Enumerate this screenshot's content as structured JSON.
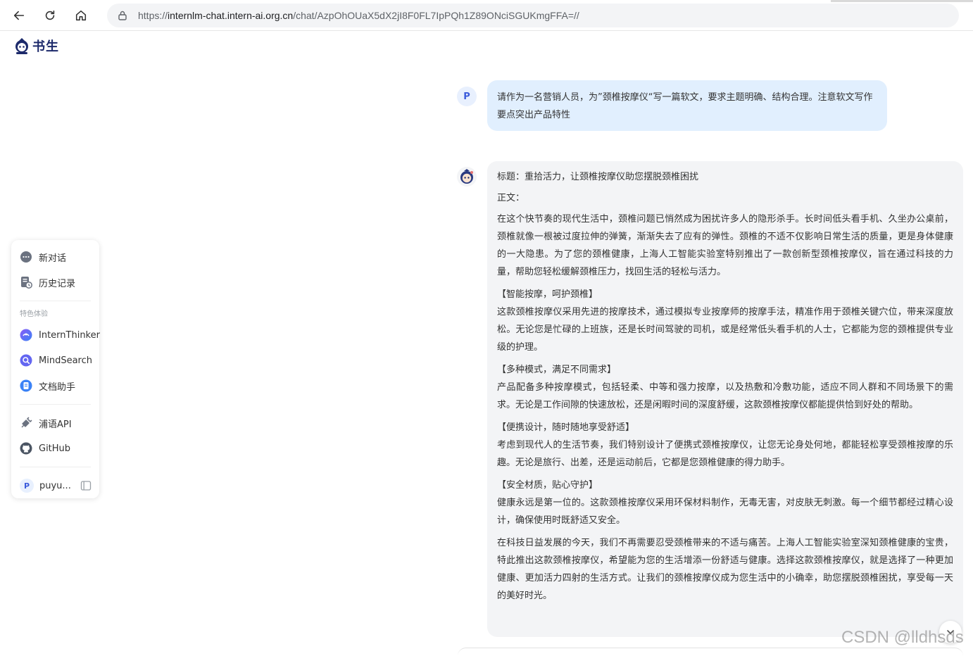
{
  "browser": {
    "url_prefix": "https://",
    "url_host": "internlm-chat.intern-ai.org.cn",
    "url_path": "/chat/AzpOhOUaX5dX2jI8F0FL7IpPQh1Z89ONciSGUKmgFFA=//"
  },
  "app": {
    "logo_text": "书生"
  },
  "sidebar": {
    "new_chat": "新对话",
    "history": "历史记录",
    "section_label": "特色体验",
    "features": [
      "InternThinker",
      "MindSearch",
      "文档助手"
    ],
    "links": [
      "浦语API",
      "GitHub"
    ],
    "user_initial": "P",
    "user_name": "puyu..."
  },
  "chat": {
    "user_initial": "P",
    "user_message": "请作为一名营销人员，为”颈椎按摩仪“写一篇软文，要求主题明确、结构合理。注意软文写作要点突出产品特性",
    "bot_paragraphs": [
      "标题：重拾活力，让颈椎按摩仪助您摆脱颈椎困扰",
      "正文：",
      "在这个快节奏的现代生活中，颈椎问题已悄然成为困扰许多人的隐形杀手。长时间低头看手机、久坐办公桌前，颈椎就像一根被过度拉伸的弹簧，渐渐失去了应有的弹性。颈椎的不适不仅影响日常生活的质量，更是身体健康的一大隐患。为了您的颈椎健康，上海人工智能实验室特别推出了一款创新型颈椎按摩仪，旨在通过科技的力量，帮助您轻松缓解颈椎压力，找回生活的轻松与活力。",
      "【智能按摩，呵护颈椎】",
      "这款颈椎按摩仪采用先进的按摩技术，通过模拟专业按摩师的按摩手法，精准作用于颈椎关键穴位，带来深度放松。无论您是忙碌的上班族，还是长时间驾驶的司机，或是经常低头看手机的人士，它都能为您的颈椎提供专业级的护理。",
      "【多种模式，满足不同需求】",
      "产品配备多种按摩模式，包括轻柔、中等和强力按摩，以及热敷和冷敷功能，适应不同人群和不同场景下的需求。无论是工作间隙的快速放松，还是闲暇时间的深度舒缓，这款颈椎按摩仪都能提供恰到好处的帮助。",
      "【便携设计，随时随地享受舒适】",
      "考虑到现代人的生活节奏，我们特别设计了便携式颈椎按摩仪，让您无论身处何地，都能轻松享受颈椎按摩的乐趣。无论是旅行、出差，还是运动前后，它都是您颈椎健康的得力助手。",
      "【安全材质，贴心守护】",
      "健康永远是第一位的。这款颈椎按摩仪采用环保材料制作，无毒无害，对皮肤无刺激。每一个细节都经过精心设计，确保使用时既舒适又安全。",
      "在科技日益发展的今天，我们不再需要忍受颈椎带来的不适与痛苦。上海人工智能实验室深知颈椎健康的宝贵，特此推出这款颈椎按摩仪，希望能为您的生活增添一份舒适与健康。选择这款颈椎按摩仪，就是选择了一种更加健康、更加活力四射的生活方式。让我们的颈椎按摩仪成为您生活中的小确幸，助您摆脱颈椎困扰，享受每一天的美好时光。"
    ]
  },
  "watermark": "CSDN @lldhsds",
  "colors": {
    "accent": "#3b5bdb",
    "user_bubble": "#e1effe",
    "bot_bubble": "#f3f4f6"
  }
}
